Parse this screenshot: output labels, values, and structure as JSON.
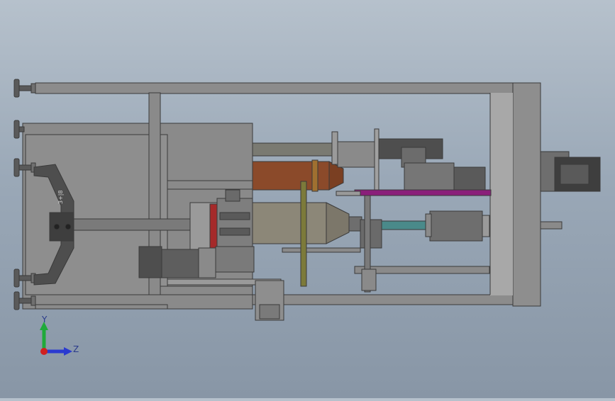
{
  "viewport": {
    "background_top": "#b6c1cc",
    "background_bottom": "#8896a6",
    "frame_color": "#8a8a8a",
    "frame_edge": "#3c3c3c",
    "accent_purple": "#8a1f7a",
    "accent_red": "#a52a2a",
    "accent_teal": "#4a8a8a",
    "accent_brown": "#8b4a2a"
  },
  "triad": {
    "y_label": "Y",
    "z_label": "Z",
    "y_color": "#1faa3a",
    "z_color": "#2a3ad0",
    "x_color": "#d02020"
  },
  "clamp_mark": "3+|8"
}
